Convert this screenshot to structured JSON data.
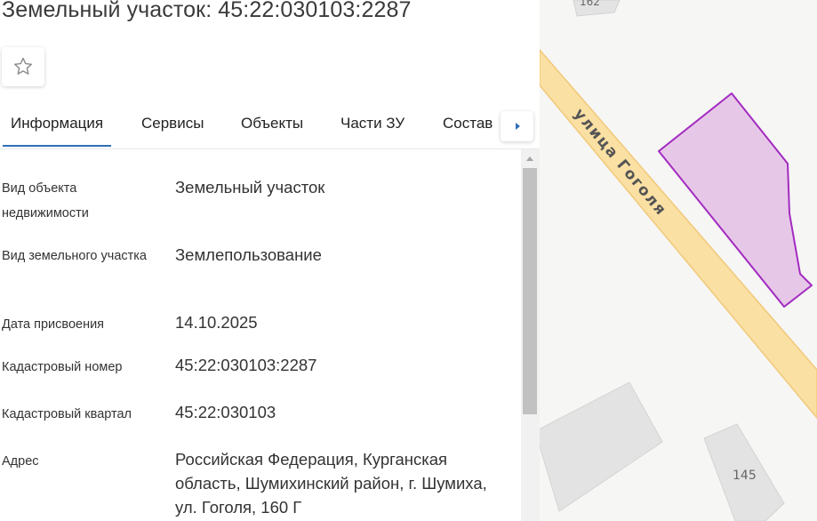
{
  "header": {
    "title": "Земельный участок: 45:22:030103:2287"
  },
  "tabs": [
    {
      "label": "Информация",
      "active": true
    },
    {
      "label": "Сервисы",
      "active": false
    },
    {
      "label": "Объекты",
      "active": false
    },
    {
      "label": "Части ЗУ",
      "active": false
    },
    {
      "label": "Состав",
      "active": false
    }
  ],
  "info": [
    {
      "label": "Вид объекта недвижимости",
      "value": "Земельный участок"
    },
    {
      "label": "Вид земельного участка",
      "value": "Землепользование"
    },
    {
      "label": "Дата присвоения",
      "value": "14.10.2025"
    },
    {
      "label": "Кадастровый номер",
      "value": "45:22:030103:2287"
    },
    {
      "label": "Кадастровый квартал",
      "value": "45:22:030103"
    },
    {
      "label": "Адрес",
      "value": "Российская Федерация, Курганская область, Шумихинский район, г. Шумиха, ул. Гоголя, 160 Г"
    }
  ],
  "map": {
    "street_label": "улица Гоголя",
    "building_labels": [
      "162",
      "145"
    ]
  },
  "colors": {
    "accent": "#2f6fb8",
    "road_fill": "#fbe0a3",
    "road_edge": "#f1c879",
    "parcel_fill": "#e7c7e8",
    "parcel_stroke": "#a22bc0",
    "building": "#e3e3e3"
  },
  "icons": {
    "favorite": "star-outline-icon",
    "tabs_next": "caret-right-icon",
    "scroll_up": "scroll-up-arrow-icon"
  }
}
